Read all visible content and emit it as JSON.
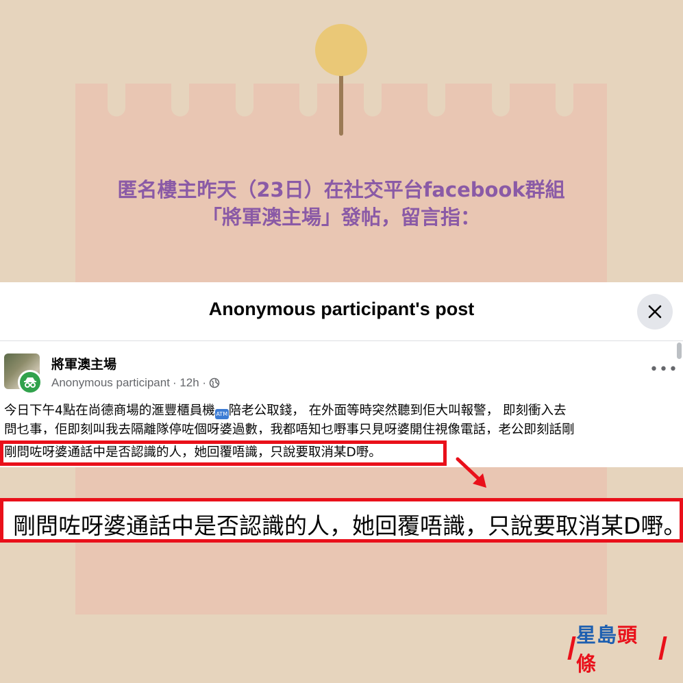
{
  "headline": {
    "line1": "匿名樓主昨天（23日）在社交平台facebook群組",
    "line2": "「將軍澳主場」發帖，留言指："
  },
  "post": {
    "title": "Anonymous participant's post",
    "close_icon": "close-icon",
    "group_name": "將軍澳主場",
    "author": "Anonymous participant",
    "time": "· 12h ·",
    "privacy_icon": "globe-icon",
    "more_label": "•••",
    "body_line1_a": "今日下午4點在尚德商場的滙豐櫃員機",
    "atm_label": "ATM",
    "body_line1_b": "陪老公取錢， 在外面等時突然聽到佢大叫報警， 即刻衝入去",
    "body_line2": "問乜事，佢即刻叫我去隔離隊停咗個呀婆過數，我都唔知乜嘢事只見呀婆開住視像電話，老公即刻話剛",
    "highlight_line": "剛問咗呀婆通話中是否認識的人，她回覆唔識，只說要取消某D嘢。"
  },
  "zoom": {
    "text": "剛問咗呀婆通話中是否認識的人，她回覆唔識，只說要取消某D嘢。"
  },
  "logo": {
    "part1": "星島",
    "part2": "頭條"
  },
  "colors": {
    "background": "#e6d4bd",
    "paper": "#e9c6b3",
    "headline": "#8a5aa6",
    "highlight_border": "#e9101a",
    "logo_blue": "#1e5fb0"
  }
}
